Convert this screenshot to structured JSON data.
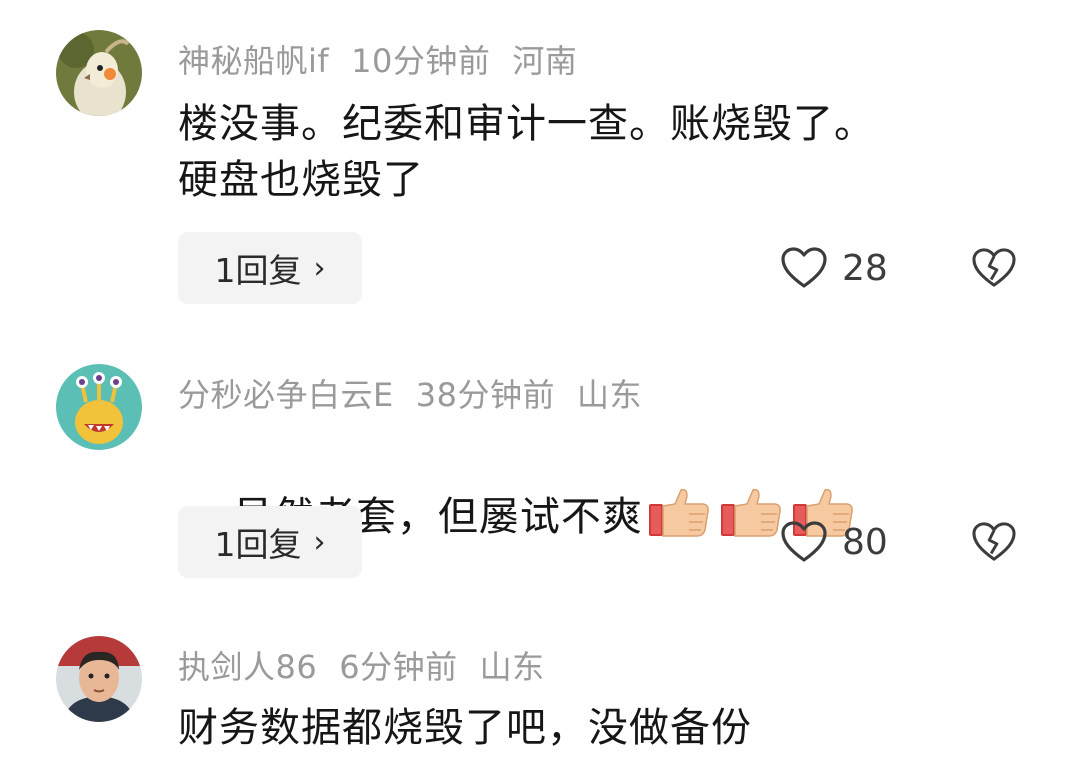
{
  "comments": [
    {
      "username": "神秘船帆if",
      "time": "10分钟前",
      "location": "河南",
      "text": "楼没事。纪委和审计一查。账烧毁了。\n硬盘也烧毁了",
      "reply_label": "1回复",
      "likes": "28",
      "avatar_icon": "cockatiel-avatar-icon"
    },
    {
      "username": "分秒必争白云E",
      "time": "38分钟前",
      "location": "山东",
      "text": "虽然老套，但屡试不爽",
      "emoji": [
        "thumbs-up-icon",
        "thumbs-up-icon",
        "thumbs-up-icon"
      ],
      "reply_label": "1回复",
      "likes": "80",
      "avatar_icon": "cartoon-monster-avatar-icon"
    },
    {
      "username": "执剑人86",
      "time": "6分钟前",
      "location": "山东",
      "text": "财务数据都烧毁了吧，没做备份",
      "avatar_icon": "man-portrait-avatar-icon"
    }
  ],
  "colors": {
    "meta_text": "#9a9a9a",
    "body_text": "#161616",
    "reply_bg": "#f3f3f3",
    "icon_stroke": "#3c3c3c"
  }
}
